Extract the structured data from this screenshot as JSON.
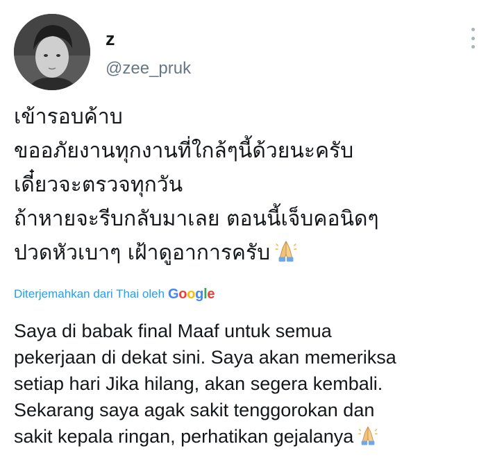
{
  "tweet": {
    "author_name": "z",
    "author_handle": "@zee_pruk",
    "menu_icon": "more-vertical-icon",
    "avatar_icon": "profile-photo",
    "original_lines": [
      "เข้ารอบค้าบ",
      "ขออภัยงานทุกงานที่ใกล้ๆนี้ด้วยนะครับ",
      "เดี๋ยวจะตรวจทุกวัน",
      "ถ้าหายจะรีบกลับมาเลย ตอนนี้เจ็บคอนิดๆ",
      "ปวดหัวเบาๆ เฝ้าดูอาการครับ"
    ],
    "translation_label": "Diterjemahkan dari Thai oleh",
    "google_letters": [
      "G",
      "o",
      "o",
      "g",
      "l",
      "e"
    ],
    "translated_lines": [
      "Saya di babak final Maaf untuk semua",
      "pekerjaan di dekat sini. Saya akan memeriksa",
      "setiap hari Jika hilang, akan segera kembali.",
      "Sekarang saya agak sakit tenggorokan dan",
      "sakit kepala ringan, perhatikan gejalanya"
    ],
    "emoji_icon": "folded-hands-icon",
    "google_colors": [
      "#4285F4",
      "#EA4335",
      "#FBBC05",
      "#4285F4",
      "#34A853",
      "#EA4335"
    ]
  }
}
